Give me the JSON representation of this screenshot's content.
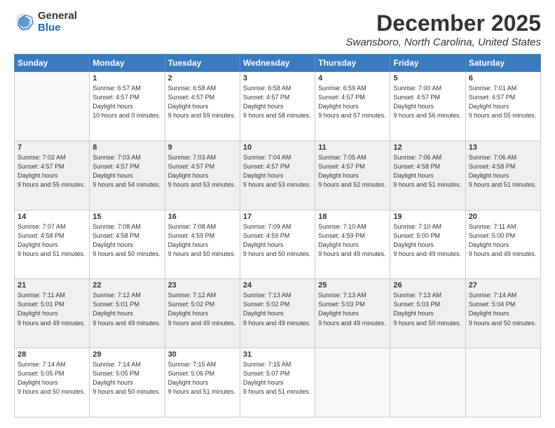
{
  "logo": {
    "general": "General",
    "blue": "Blue"
  },
  "header": {
    "month": "December 2025",
    "location": "Swansboro, North Carolina, United States"
  },
  "weekdays": [
    "Sunday",
    "Monday",
    "Tuesday",
    "Wednesday",
    "Thursday",
    "Friday",
    "Saturday"
  ],
  "weeks": [
    [
      {
        "day": "",
        "empty": true
      },
      {
        "day": "1",
        "sunrise": "6:57 AM",
        "sunset": "4:57 PM",
        "daylight": "10 hours and 0 minutes."
      },
      {
        "day": "2",
        "sunrise": "6:58 AM",
        "sunset": "4:57 PM",
        "daylight": "9 hours and 59 minutes."
      },
      {
        "day": "3",
        "sunrise": "6:58 AM",
        "sunset": "4:57 PM",
        "daylight": "9 hours and 58 minutes."
      },
      {
        "day": "4",
        "sunrise": "6:59 AM",
        "sunset": "4:57 PM",
        "daylight": "9 hours and 57 minutes."
      },
      {
        "day": "5",
        "sunrise": "7:00 AM",
        "sunset": "4:57 PM",
        "daylight": "9 hours and 56 minutes."
      },
      {
        "day": "6",
        "sunrise": "7:01 AM",
        "sunset": "4:57 PM",
        "daylight": "9 hours and 55 minutes."
      }
    ],
    [
      {
        "day": "7",
        "sunrise": "7:02 AM",
        "sunset": "4:57 PM",
        "daylight": "9 hours and 55 minutes."
      },
      {
        "day": "8",
        "sunrise": "7:03 AM",
        "sunset": "4:57 PM",
        "daylight": "9 hours and 54 minutes."
      },
      {
        "day": "9",
        "sunrise": "7:03 AM",
        "sunset": "4:57 PM",
        "daylight": "9 hours and 53 minutes."
      },
      {
        "day": "10",
        "sunrise": "7:04 AM",
        "sunset": "4:57 PM",
        "daylight": "9 hours and 53 minutes."
      },
      {
        "day": "11",
        "sunrise": "7:05 AM",
        "sunset": "4:57 PM",
        "daylight": "9 hours and 52 minutes."
      },
      {
        "day": "12",
        "sunrise": "7:06 AM",
        "sunset": "4:58 PM",
        "daylight": "9 hours and 51 minutes."
      },
      {
        "day": "13",
        "sunrise": "7:06 AM",
        "sunset": "4:58 PM",
        "daylight": "9 hours and 51 minutes."
      }
    ],
    [
      {
        "day": "14",
        "sunrise": "7:07 AM",
        "sunset": "4:58 PM",
        "daylight": "9 hours and 51 minutes."
      },
      {
        "day": "15",
        "sunrise": "7:08 AM",
        "sunset": "4:58 PM",
        "daylight": "9 hours and 50 minutes."
      },
      {
        "day": "16",
        "sunrise": "7:08 AM",
        "sunset": "4:59 PM",
        "daylight": "9 hours and 50 minutes."
      },
      {
        "day": "17",
        "sunrise": "7:09 AM",
        "sunset": "4:59 PM",
        "daylight": "9 hours and 50 minutes."
      },
      {
        "day": "18",
        "sunrise": "7:10 AM",
        "sunset": "4:59 PM",
        "daylight": "9 hours and 49 minutes."
      },
      {
        "day": "19",
        "sunrise": "7:10 AM",
        "sunset": "5:00 PM",
        "daylight": "9 hours and 49 minutes."
      },
      {
        "day": "20",
        "sunrise": "7:11 AM",
        "sunset": "5:00 PM",
        "daylight": "9 hours and 49 minutes."
      }
    ],
    [
      {
        "day": "21",
        "sunrise": "7:11 AM",
        "sunset": "5:01 PM",
        "daylight": "9 hours and 49 minutes."
      },
      {
        "day": "22",
        "sunrise": "7:12 AM",
        "sunset": "5:01 PM",
        "daylight": "9 hours and 49 minutes."
      },
      {
        "day": "23",
        "sunrise": "7:12 AM",
        "sunset": "5:02 PM",
        "daylight": "9 hours and 49 minutes."
      },
      {
        "day": "24",
        "sunrise": "7:13 AM",
        "sunset": "5:02 PM",
        "daylight": "9 hours and 49 minutes."
      },
      {
        "day": "25",
        "sunrise": "7:13 AM",
        "sunset": "5:03 PM",
        "daylight": "9 hours and 49 minutes."
      },
      {
        "day": "26",
        "sunrise": "7:13 AM",
        "sunset": "5:03 PM",
        "daylight": "9 hours and 50 minutes."
      },
      {
        "day": "27",
        "sunrise": "7:14 AM",
        "sunset": "5:04 PM",
        "daylight": "9 hours and 50 minutes."
      }
    ],
    [
      {
        "day": "28",
        "sunrise": "7:14 AM",
        "sunset": "5:05 PM",
        "daylight": "9 hours and 50 minutes."
      },
      {
        "day": "29",
        "sunrise": "7:14 AM",
        "sunset": "5:05 PM",
        "daylight": "9 hours and 50 minutes."
      },
      {
        "day": "30",
        "sunrise": "7:15 AM",
        "sunset": "5:06 PM",
        "daylight": "9 hours and 51 minutes."
      },
      {
        "day": "31",
        "sunrise": "7:15 AM",
        "sunset": "5:07 PM",
        "daylight": "9 hours and 51 minutes."
      },
      {
        "day": "",
        "empty": true
      },
      {
        "day": "",
        "empty": true
      },
      {
        "day": "",
        "empty": true
      }
    ]
  ]
}
